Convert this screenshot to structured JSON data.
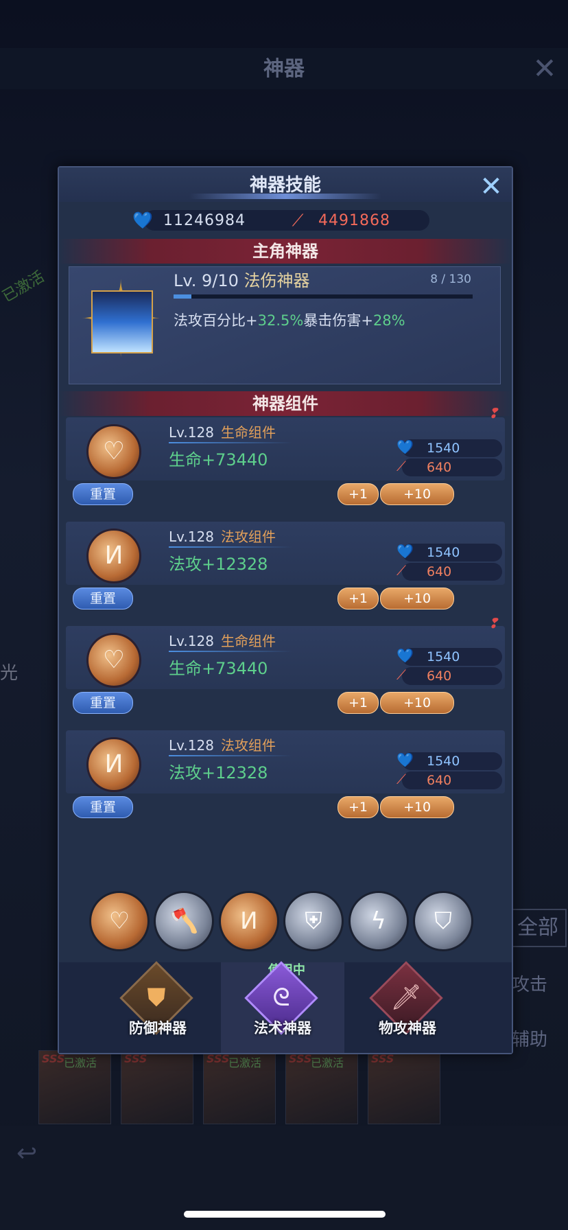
{
  "background": {
    "title": "神器",
    "left_tag": "已激活",
    "left_text": "光",
    "right_filter_all": "全部",
    "right_filter_attack": "攻击",
    "right_filter_assist": "辅助",
    "cards": [
      {
        "tag": "SSS",
        "status": "已激活"
      },
      {
        "tag": "SSS",
        "status": ""
      },
      {
        "tag": "SSS",
        "status": "已激活"
      },
      {
        "tag": "SSS",
        "status": "已激活"
      },
      {
        "tag": "SSS",
        "status": ""
      }
    ]
  },
  "modal": {
    "title": "神器技能",
    "currency": {
      "blue_value": "11246984",
      "red_value": "4491868"
    },
    "main_section_title": "主角神器",
    "main_artifact": {
      "level_prefix": "Lv.",
      "level": "9/10",
      "type": "法伤神器",
      "exp": "8 / 130",
      "exp_fraction": 0.06,
      "effect_a_label": "法攻百分比+",
      "effect_a_value": "32.5%",
      "effect_b_label": "暴击伤害+",
      "effect_b_value": "28%"
    },
    "components_section_title": "神器组件",
    "components": [
      {
        "level": "Lv.128",
        "name": "生命组件",
        "stat": "生命+73440",
        "cost_blue": "1540",
        "cost_red": "640",
        "icon": "heart-icon",
        "badge": true
      },
      {
        "level": "Lv.128",
        "name": "法攻组件",
        "stat": "法攻+12328",
        "cost_blue": "1540",
        "cost_red": "640",
        "icon": "rune-icon",
        "badge": false
      },
      {
        "level": "Lv.128",
        "name": "生命组件",
        "stat": "生命+73440",
        "cost_blue": "1540",
        "cost_red": "640",
        "icon": "heart-icon",
        "badge": true
      },
      {
        "level": "Lv.128",
        "name": "法攻组件",
        "stat": "法攻+12328",
        "cost_blue": "1540",
        "cost_red": "640",
        "icon": "rune-icon",
        "badge": false
      }
    ],
    "buttons": {
      "reset": "重置",
      "plus1": "+1",
      "plus10": "+10"
    },
    "component_icons": [
      "heart-icon",
      "axe-icon",
      "rune-icon",
      "helmet-icon",
      "lightning-shield-icon",
      "shield-regen-icon"
    ],
    "tabs": [
      {
        "label": "防御神器",
        "active": false
      },
      {
        "label": "法术神器",
        "active": true,
        "status": "使用中"
      },
      {
        "label": "物攻神器",
        "active": false
      }
    ]
  }
}
